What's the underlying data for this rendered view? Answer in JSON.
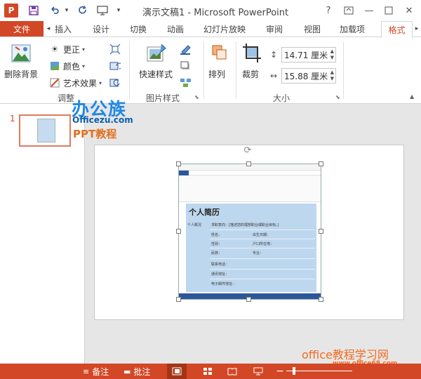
{
  "titlebar": {
    "app_icon_letter": "P",
    "title": "演示文稿1 - Microsoft PowerPoint",
    "help": "?"
  },
  "tabs": {
    "file": "文件",
    "items": [
      "插入",
      "设计",
      "切换",
      "动画",
      "幻灯片放映",
      "审阅",
      "视图",
      "加载项",
      "格式"
    ]
  },
  "ribbon": {
    "adjust": {
      "remove_bg": "删除背景",
      "corrections": "更正",
      "color": "颜色",
      "artistic": "艺术效果",
      "group_label": "调整"
    },
    "picture_styles": {
      "quick_styles": "快速样式",
      "group_label": "图片样式"
    },
    "arrange": {
      "label": "排列"
    },
    "size": {
      "crop": "裁剪",
      "height": "14.71 厘米",
      "width": "15.88 厘米",
      "group_label": "大小"
    }
  },
  "thumbnails": {
    "slide_number": "1"
  },
  "watermark": {
    "logo_title": "办公族",
    "logo_site": "Officezu.com",
    "logo_sub": "PPT教程",
    "bottom_title": "office教程学习网",
    "bottom_url": "www.office68.com"
  },
  "picture": {
    "doc_title": "个人简历",
    "section": "个人概况",
    "intent": "求职意向：[描述您的理想职业或职业目标。]",
    "fields": [
      "姓名：",
      "出生日期：",
      "性别：",
      "户口所在地：",
      "民族：",
      "专业：",
      "联系电话：",
      "通讯地址：",
      "电子邮件地址："
    ]
  },
  "statusbar": {
    "notes": "备注",
    "comments": "批注"
  },
  "colors": {
    "accent": "#d24726",
    "watermark_blue": "#1e88e5",
    "watermark_orange": "#f26b1d"
  }
}
